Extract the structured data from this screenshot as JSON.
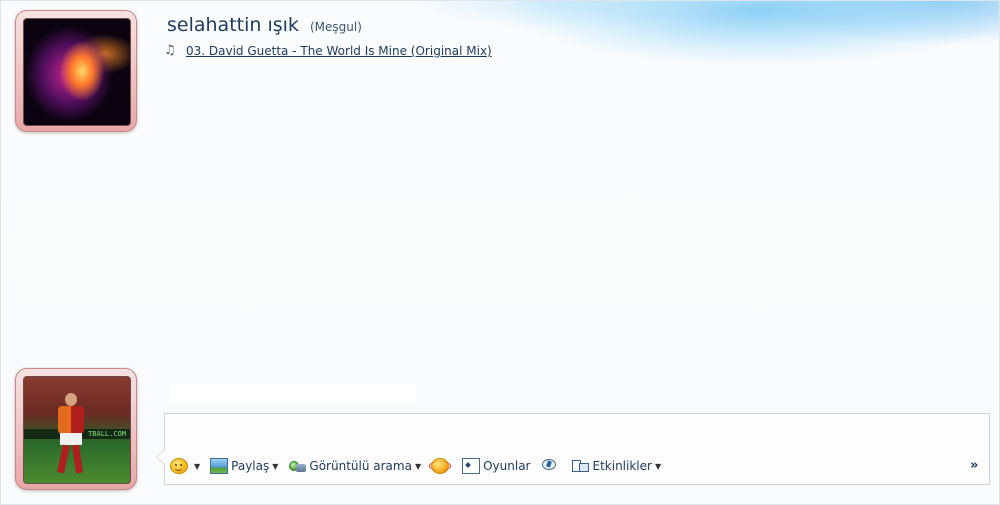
{
  "contact": {
    "name": "selahattin ışık",
    "status": "(Meşgul)",
    "now_playing": "03. David Guetta - The World Is Mine (Original Mix)"
  },
  "user": {
    "board_text": "TBALL.COM"
  },
  "input": {
    "value": "",
    "placeholder": ""
  },
  "toolbar": {
    "share_label": "Paylaş",
    "video_call_label": "Görüntülü arama",
    "games_label": "Oyunlar",
    "activities_label": "Etkinlikler",
    "more_label": "»"
  },
  "icons": {
    "music": "music-note-icon",
    "emoticon": "emoticon-icon",
    "share": "share-icon",
    "video": "video-call-icon",
    "nudge": "nudge-icon",
    "games": "games-icon",
    "activity_tool": "action-icon",
    "activities": "activities-icon"
  },
  "colors": {
    "accent_blue": "#8fd0f5",
    "avatar_frame": "#e9a7a7",
    "text": "#1e395b"
  }
}
